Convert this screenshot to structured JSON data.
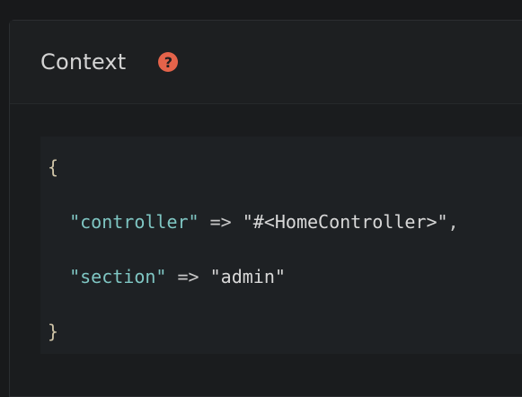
{
  "panel": {
    "title": "Context",
    "help_icon": "question-circle-icon",
    "help_glyph": "?"
  },
  "code": {
    "open_brace": "{",
    "close_brace": "}",
    "entries": [
      {
        "key": "\"controller\"",
        "arrow": " => ",
        "value": "\"#<HomeController>\"",
        "trail": ","
      },
      {
        "key": "\"section\"",
        "arrow": " => ",
        "value": "\"admin\"",
        "trail": ""
      }
    ]
  },
  "colors": {
    "help_icon": "#e4634a",
    "key": "#7fc6c3",
    "brace": "#d0c5a8",
    "background": "#1c1e20"
  }
}
